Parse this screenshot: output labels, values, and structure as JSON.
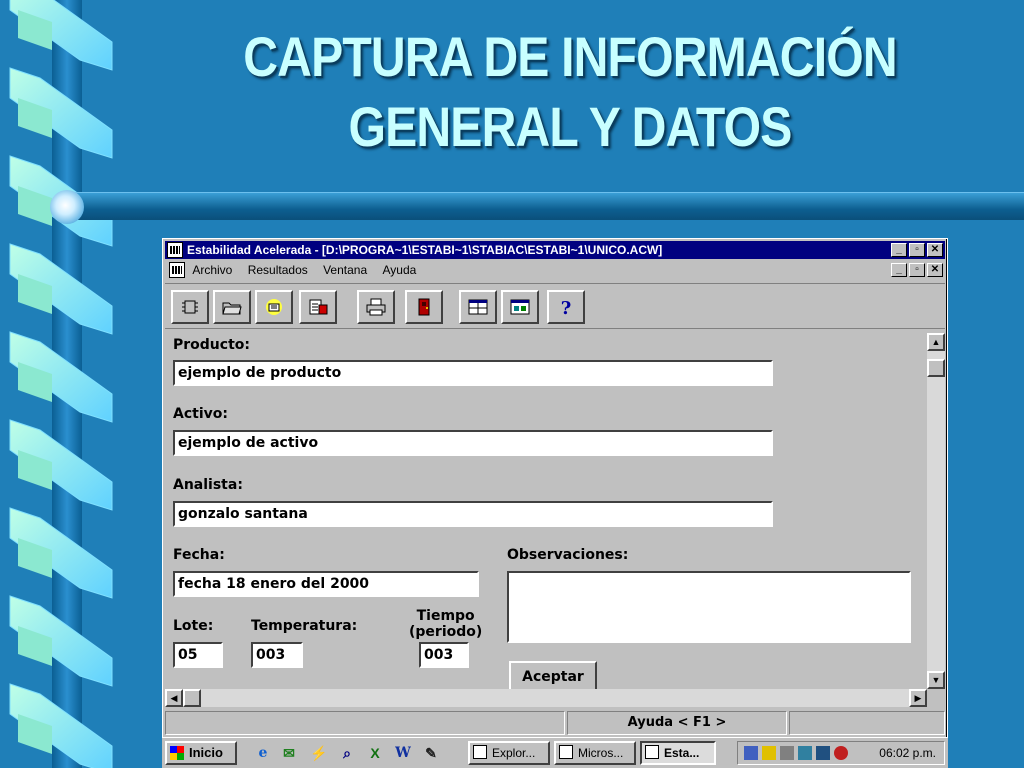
{
  "slide": {
    "title_line1": "CAPTURA DE INFORMACIÓN",
    "title_line2": "GENERAL Y DATOS"
  },
  "window": {
    "title": "Estabilidad Acelerada  - [D:\\PROGRA~1\\ESTABI~1\\STABIAC\\ESTABI~1\\UNICO.ACW]",
    "minimize": "_",
    "restore": "▫",
    "close": "✕"
  },
  "menu": {
    "archivo": "Archivo",
    "resultados": "Resultados",
    "ventana": "Ventana",
    "ayuda": "Ayuda"
  },
  "toolbar": {
    "icons": [
      "new-chip-icon",
      "open-folder-icon",
      "highlight-icon",
      "edit-document-icon",
      "print-icon",
      "exit-door-icon",
      "grid-view-icon",
      "chart-view-icon",
      "help-icon"
    ]
  },
  "form": {
    "producto_label": "Producto:",
    "producto_value": "ejemplo de producto",
    "activo_label": "Activo:",
    "activo_value": "ejemplo de activo",
    "analista_label": "Analista:",
    "analista_value": "gonzalo santana",
    "fecha_label": "Fecha:",
    "fecha_value": "fecha 18 enero del 2000",
    "observaciones_label": "Observaciones:",
    "observaciones_value": "",
    "lote_label": "Lote:",
    "lote_value": "05",
    "temperatura_label": "Temperatura:",
    "temperatura_value": "003",
    "tiempo_label_1": "Tiempo",
    "tiempo_label_2": "(periodo)",
    "tiempo_value": "003",
    "aceptar": "Aceptar"
  },
  "statusbar": {
    "help": "Ayuda < F1 >"
  },
  "taskbar": {
    "start": "Inicio",
    "tasks": [
      "Explor...",
      "Micros...",
      "Esta..."
    ],
    "clock": "06:02 p.m."
  },
  "colors": {
    "background": "#1f7fb8",
    "title": "#c8ffff",
    "titlebar": "#000080",
    "window": "#c0c0c0"
  }
}
